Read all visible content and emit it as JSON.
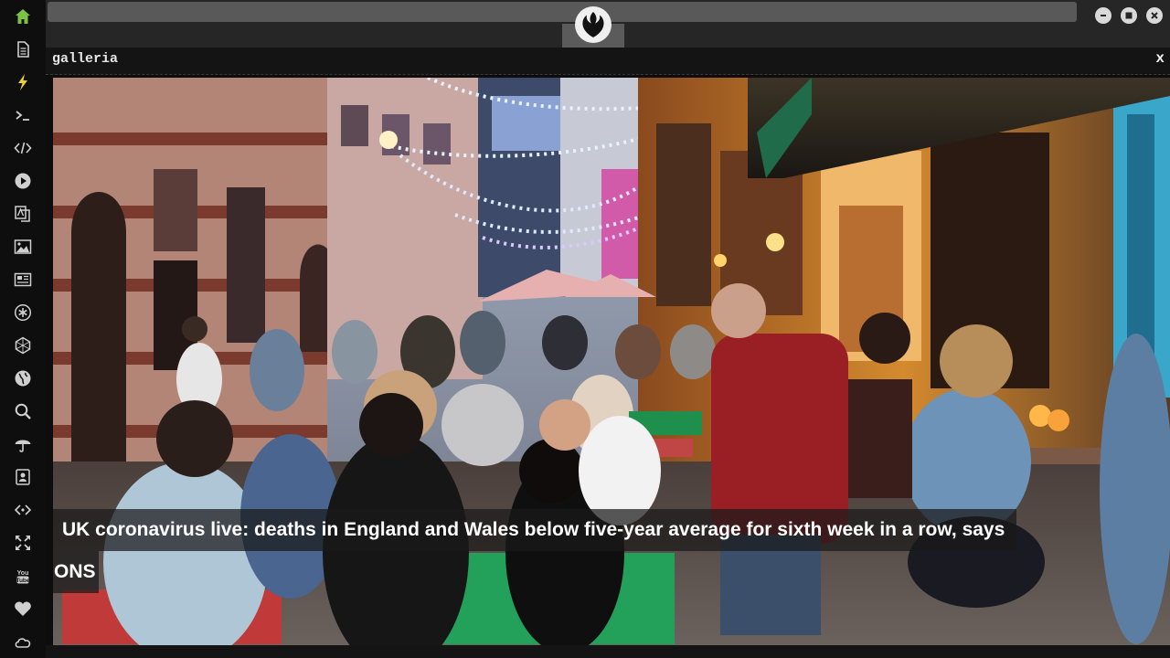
{
  "window": {
    "title": "galleria",
    "close_label": "x"
  },
  "sidebar": {
    "items": [
      {
        "icon": "home-icon",
        "active": true
      },
      {
        "icon": "document-icon"
      },
      {
        "icon": "lightning-icon"
      },
      {
        "icon": "terminal-icon"
      },
      {
        "icon": "code-icon"
      },
      {
        "icon": "play-icon"
      },
      {
        "icon": "translate-icon"
      },
      {
        "icon": "image-icon"
      },
      {
        "icon": "newspaper-icon"
      },
      {
        "icon": "asterisk-icon"
      },
      {
        "icon": "hexagon-icon"
      },
      {
        "icon": "globe-icon"
      },
      {
        "icon": "search-icon"
      },
      {
        "icon": "umbrella-icon"
      },
      {
        "icon": "contact-icon"
      },
      {
        "icon": "embed-icon"
      },
      {
        "icon": "expand-icon"
      },
      {
        "icon": "youtube-icon"
      },
      {
        "icon": "heart-icon"
      },
      {
        "icon": "cloud-icon"
      }
    ]
  },
  "colors": {
    "accent_active": "#7cc243",
    "icon": "#cfcfcf"
  },
  "gallery": {
    "caption": "UK coronavirus live: deaths in England and Wales below five-year average for sixth week in a row, says",
    "caption_wrap": "ONS"
  }
}
